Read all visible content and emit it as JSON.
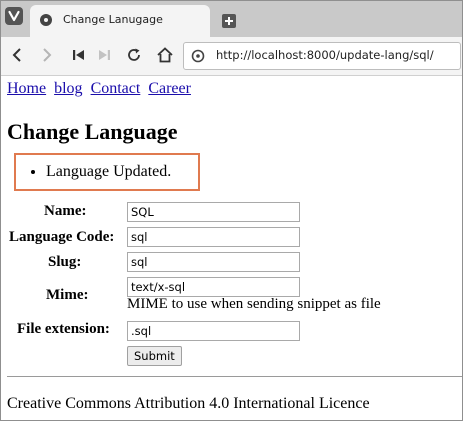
{
  "browser": {
    "tab_title": "Change Lanugage",
    "url": "http://localhost:8000/update-lang/sql/"
  },
  "nav": {
    "links": [
      "Home",
      "blog",
      "Contact",
      "Career"
    ]
  },
  "page": {
    "title": "Change Language",
    "messages": [
      "Language Updated."
    ]
  },
  "form": {
    "name_label": "Name:",
    "name_value": "SQL",
    "lang_code_label": "Language Code:",
    "lang_code_value": "sql",
    "slug_label": "Slug:",
    "slug_value": "sql",
    "mime_label": "Mime:",
    "mime_value": "text/x-sql",
    "mime_help": "MIME to use when sending snippet as file",
    "file_ext_label": "File extension:",
    "file_ext_value": ".sql",
    "submit_label": "Submit"
  },
  "footer": {
    "text": "Creative Commons Attribution 4.0 International Licence"
  },
  "colors": {
    "highlight_border": "#e07a4f",
    "link": "#1a0dab"
  }
}
